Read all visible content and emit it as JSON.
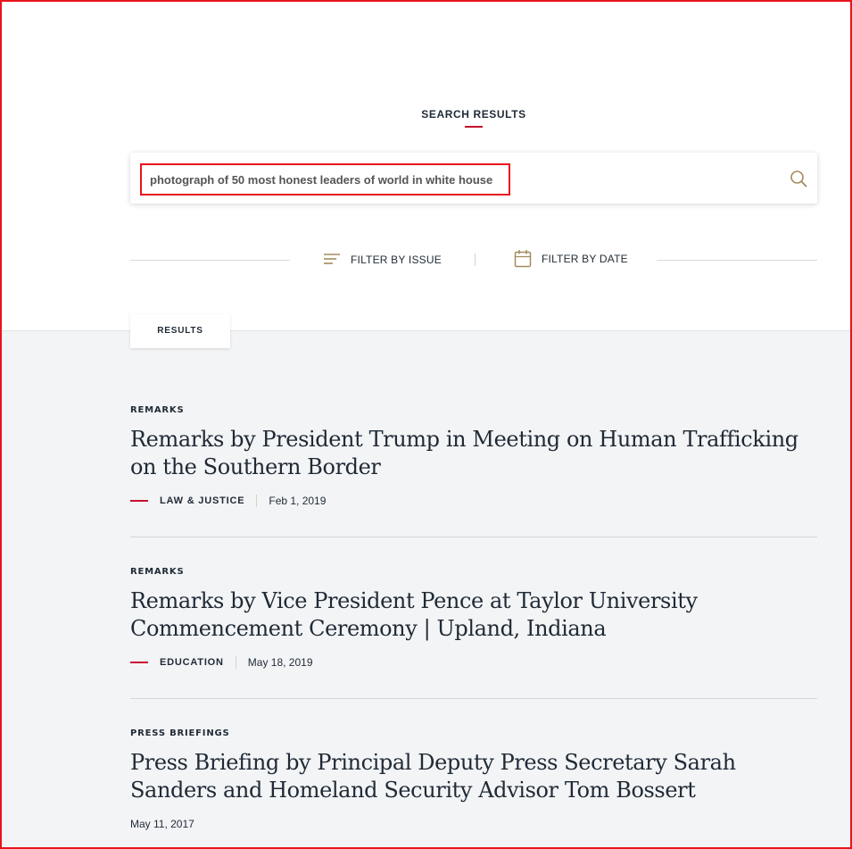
{
  "page": {
    "heading": "SEARCH RESULTS"
  },
  "search": {
    "query": "photograph of 50 most honest leaders of world in white house"
  },
  "filters": {
    "issue_label": "FILTER BY ISSUE",
    "date_label": "FILTER BY DATE"
  },
  "results_tab": {
    "label": "RESULTS"
  },
  "results": [
    {
      "category": "REMARKS",
      "title": "Remarks by President Trump in Meeting on Human Trafficking on the Southern Border",
      "issue": "LAW & JUSTICE",
      "date": "Feb 1, 2019"
    },
    {
      "category": "REMARKS",
      "title": "Remarks by Vice President Pence at Taylor University Commencement Ceremony | Upland, Indiana",
      "issue": "EDUCATION",
      "date": "May 18, 2019"
    },
    {
      "category": "PRESS BRIEFINGS",
      "title": "Press Briefing by Principal Deputy Press Secretary Sarah Sanders and Homeland Security Advisor Tom Bossert",
      "date": "May 11, 2017"
    }
  ],
  "colors": {
    "accent": "#c8102e",
    "icon": "#a38b5e",
    "text": "#1f2a35",
    "page_bg": "#f3f4f6"
  }
}
